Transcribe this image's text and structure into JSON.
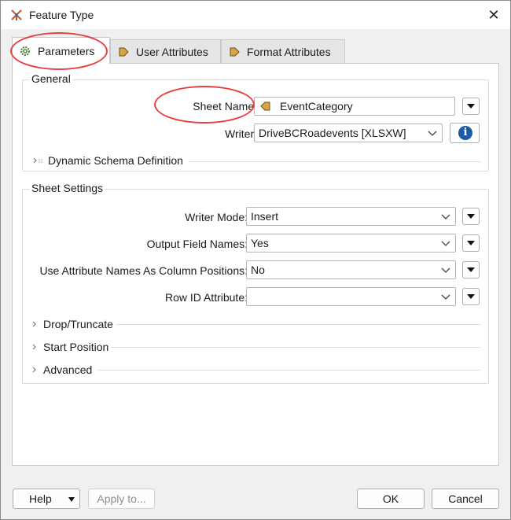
{
  "window": {
    "title": "Feature Type",
    "close_glyph": "✕"
  },
  "tabs": [
    {
      "label": "Parameters",
      "icon": "gear-icon",
      "active": true
    },
    {
      "label": "User Attributes",
      "icon": "attribute-arrow-icon",
      "active": false
    },
    {
      "label": "Format Attributes",
      "icon": "attribute-arrow-icon",
      "active": false
    }
  ],
  "general": {
    "title": "General",
    "sheet_name_label": "Sheet Name:",
    "sheet_name_value": "EventCategory",
    "writer_label": "Writer:",
    "writer_value": "DriveBCRoadevents [XLSXW]",
    "dynamic_schema_label": "Dynamic Schema Definition"
  },
  "sheet_settings": {
    "title": "Sheet Settings",
    "writer_mode_label": "Writer Mode:",
    "writer_mode_value": "Insert",
    "output_field_names_label": "Output Field Names:",
    "output_field_names_value": "Yes",
    "use_attr_names_label": "Use Attribute Names As Column Positions:",
    "use_attr_names_value": "No",
    "row_id_label": "Row ID Attribute:",
    "row_id_value": "",
    "sections": [
      "Drop/Truncate",
      "Start Position",
      "Advanced"
    ]
  },
  "footer": {
    "help_label": "Help",
    "apply_label": "Apply to...",
    "ok_label": "OK",
    "cancel_label": "Cancel"
  },
  "colors": {
    "annotation": "#e54040",
    "info_blue": "#1f5aa6"
  }
}
